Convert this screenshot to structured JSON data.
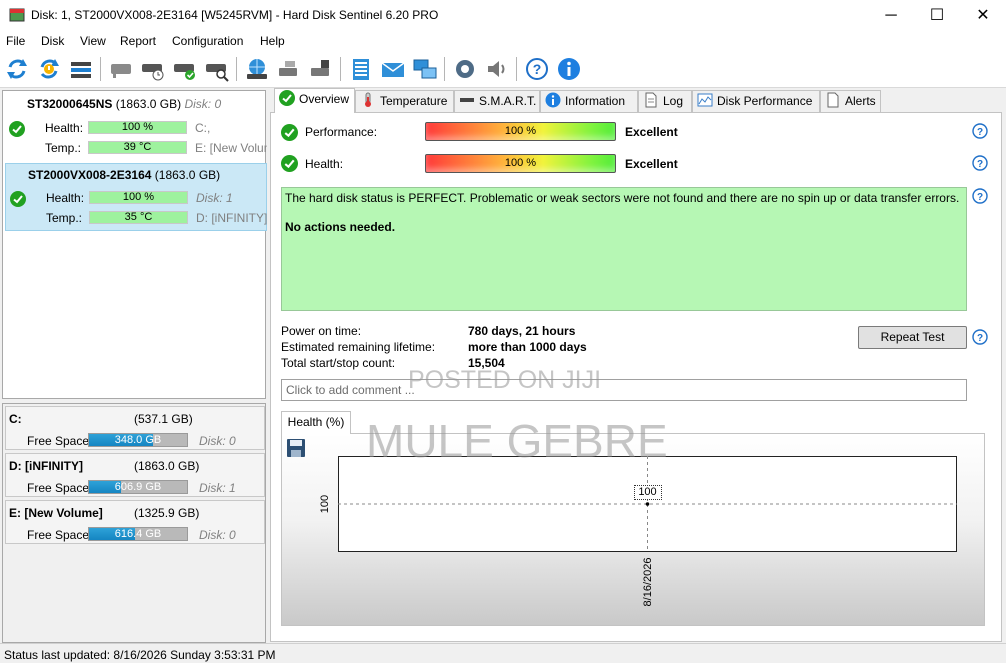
{
  "window": {
    "title": "Disk: 1, ST2000VX008-2E3164 [W5245RVM]  -  Hard Disk Sentinel 6.20 PRO",
    "minimize": "─",
    "maximize": "☐",
    "close": "✕"
  },
  "menu": [
    "File",
    "Disk",
    "View",
    "Report",
    "Configuration",
    "Help"
  ],
  "toolbar_icons": [
    "refresh-icon",
    "refresh-alert-icon",
    "disk-list-icon",
    "disk-gray-icon",
    "disk-clock-icon",
    "disk-check-icon",
    "disk-search-icon",
    "globe-disk-icon",
    "disk-tools-icon",
    "disk-power-icon",
    "clipboard-report-icon",
    "mail-icon",
    "network-icon",
    "settings-gear-icon",
    "speaker-icon",
    "help-icon",
    "info-icon"
  ],
  "disks": [
    {
      "name": "ST32000645NS",
      "size": "(1863.0 GB)",
      "disk": "Disk: 0",
      "health_label": "Health:",
      "health": "100 %",
      "health_fraction": 1.0,
      "temp_label": "Temp.:",
      "temp": "39 °C",
      "vol1": "C:,",
      "vol2": "E: [New Volume]"
    },
    {
      "name": "ST2000VX008-2E3164",
      "size": "(1863.0 GB)",
      "disk": "Disk: 1",
      "health_label": "Health:",
      "health": "100 %",
      "health_fraction": 1.0,
      "temp_label": "Temp.:",
      "temp": "35 °C",
      "vol1": "Disk: 1",
      "vol2": "D: [iNFINITY]"
    }
  ],
  "volumes": [
    {
      "name": "C:",
      "size": "(537.1 GB)",
      "free_label": "Free Space",
      "free": "348.0 GB",
      "free_fraction": 0.648,
      "disk": "Disk: 0"
    },
    {
      "name": "D: [iNFINITY]",
      "size": "(1863.0 GB)",
      "free_label": "Free Space",
      "free": "606.9 GB",
      "free_fraction": 0.326,
      "disk": "Disk: 1"
    },
    {
      "name": "E: [New Volume]",
      "size": "(1325.9 GB)",
      "free_label": "Free Space",
      "free": "616.4 GB",
      "free_fraction": 0.465,
      "disk": "Disk: 0"
    }
  ],
  "tabs": [
    "Overview",
    "Temperature",
    "S.M.A.R.T.",
    "Information",
    "Log",
    "Disk Performance",
    "Alerts"
  ],
  "overview": {
    "performance_label": "Performance:",
    "performance_value": "100 %",
    "performance_fraction": 1.0,
    "performance_rating": "Excellent",
    "health_label": "Health:",
    "health_value": "100 %",
    "health_fraction": 1.0,
    "health_rating": "Excellent",
    "status_text": "The hard disk status is PERFECT. Problematic or weak sectors were not found and there are no spin up or data transfer errors.",
    "actions_text": "No actions needed.",
    "power_on_label": "Power on time:",
    "power_on_value": "780 days, 21 hours",
    "lifetime_label": "Estimated remaining lifetime:",
    "lifetime_value": "more than 1000 days",
    "startstop_label": "Total start/stop count:",
    "startstop_value": "15,504",
    "repeat_test": "Repeat Test",
    "comment_placeholder": "Click to add comment ..."
  },
  "graph": {
    "tab_label": "Health (%)"
  },
  "chart_data": {
    "type": "line",
    "x": [
      "8/16/2026"
    ],
    "series": [
      {
        "values": [
          100
        ]
      }
    ],
    "data_labels": [
      "100"
    ],
    "ytick": "100",
    "xtick": "8/16/2026"
  },
  "watermark": {
    "line1": "POSTED ON JIJI",
    "line2": "MULE GEBRE"
  },
  "status": "Status last updated: 8/16/2026 Sunday 3:53:31 PM"
}
